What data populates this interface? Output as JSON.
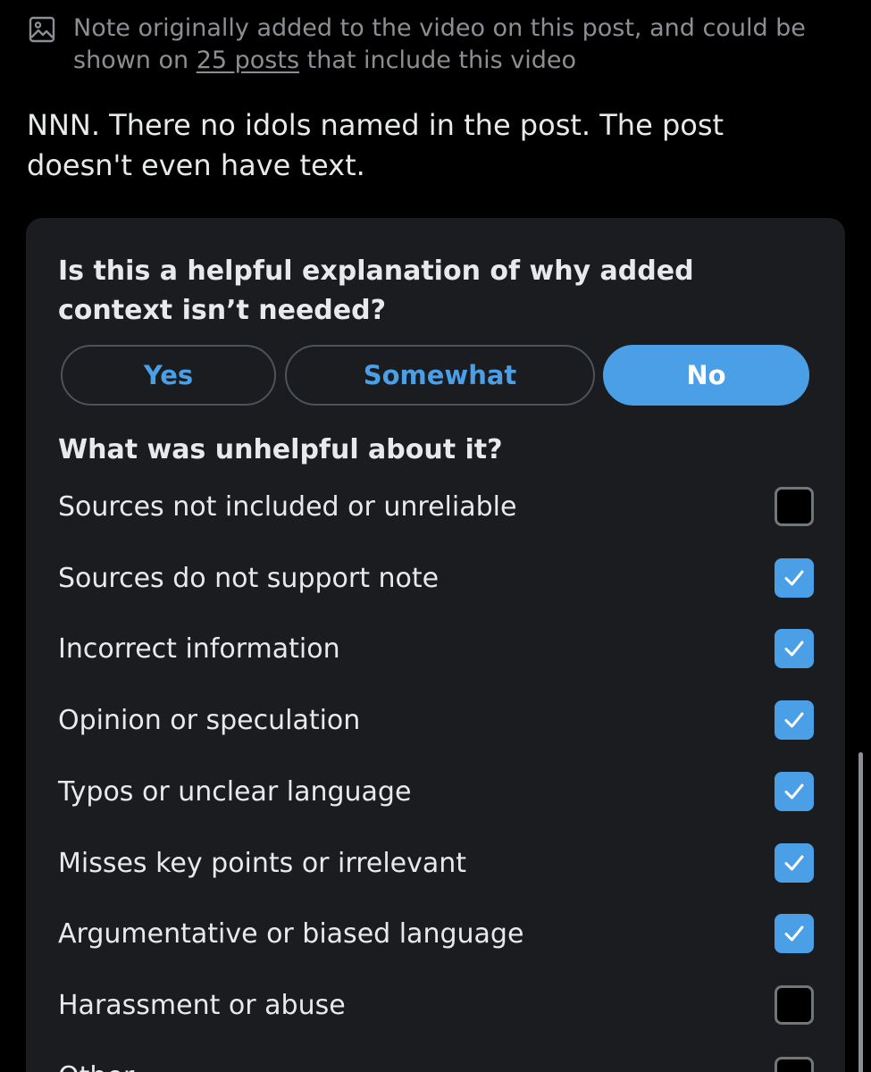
{
  "origin": {
    "text_before": "Note originally added to the video on this post, and could be shown on ",
    "link": "25 posts",
    "text_after": " that include this video",
    "icon": "image-icon"
  },
  "note": {
    "body": "NNN. There no idols named in the post. The post doesn't even have text."
  },
  "rating": {
    "question": "Is this a helpful explanation of why added context isn’t needed?",
    "options": [
      "Yes",
      "Somewhat",
      "No"
    ],
    "selected": "No"
  },
  "unhelpful": {
    "question": "What was unhelpful about it?",
    "items": [
      {
        "label": "Sources not included or unreliable",
        "checked": false
      },
      {
        "label": "Sources do not support note",
        "checked": true
      },
      {
        "label": "Incorrect information",
        "checked": true
      },
      {
        "label": "Opinion or speculation",
        "checked": true
      },
      {
        "label": "Typos or unclear language",
        "checked": true
      },
      {
        "label": "Misses key points or irrelevant",
        "checked": true
      },
      {
        "label": "Argumentative or biased language",
        "checked": true
      },
      {
        "label": "Harassment or abuse",
        "checked": false
      },
      {
        "label": "Other",
        "checked": false
      }
    ]
  },
  "colors": {
    "accent": "#4a9fe6",
    "background": "#000000",
    "card": "#1a1c20",
    "muted_text": "#8b8f94"
  }
}
